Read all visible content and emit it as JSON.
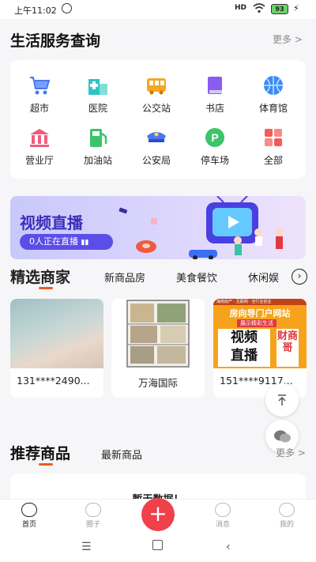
{
  "status": {
    "time": "上午11:02",
    "signal": "HD",
    "battery": "93"
  },
  "services": {
    "title": "生活服务查询",
    "more": "更多 >",
    "items": [
      {
        "label": "超市",
        "icon": "shopping-cart-icon",
        "color": "#4a78f5"
      },
      {
        "label": "医院",
        "icon": "hospital-icon",
        "color": "#2fc4c4"
      },
      {
        "label": "公交站",
        "icon": "bus-icon",
        "color": "#f5a623"
      },
      {
        "label": "书店",
        "icon": "book-icon",
        "color": "#8a5cf0"
      },
      {
        "label": "体育馆",
        "icon": "basketball-icon",
        "color": "#3c8cf5"
      },
      {
        "label": "营业厅",
        "icon": "bank-icon",
        "color": "#f25c7c"
      },
      {
        "label": "加油站",
        "icon": "gas-pump-icon",
        "color": "#3cc46a"
      },
      {
        "label": "公安局",
        "icon": "police-icon",
        "color": "#4a78f5"
      },
      {
        "label": "停车场",
        "icon": "parking-icon",
        "color": "#3cc46a"
      },
      {
        "label": "全部",
        "icon": "grid-icon",
        "color": "#f25c5c"
      }
    ]
  },
  "banner": {
    "title": "视频直播",
    "badge": "0人正在直播"
  },
  "merchants": {
    "tabs": [
      "精选商家",
      "新商品房",
      "美食餐饮",
      "休闲娱"
    ],
    "cards": [
      {
        "caption": "131****2490..."
      },
      {
        "caption": "万海国际"
      },
      {
        "caption": "151****9117...",
        "poster_top": "房向导门户网站",
        "poster_sub": "展示精彩生活",
        "poster_big1": "视频",
        "poster_big2": "直播",
        "poster_side": "财商哥",
        "poster_strip": "海南房产 · 互联网 · 全行业创业"
      }
    ]
  },
  "recommend": {
    "tabs": [
      "推荐商品",
      "最新商品"
    ],
    "more": "更多 >",
    "card_title": "暂无数据！"
  },
  "tabbar": {
    "items": [
      "首页",
      "圈子",
      "消息",
      "我的"
    ],
    "fab": "+"
  }
}
